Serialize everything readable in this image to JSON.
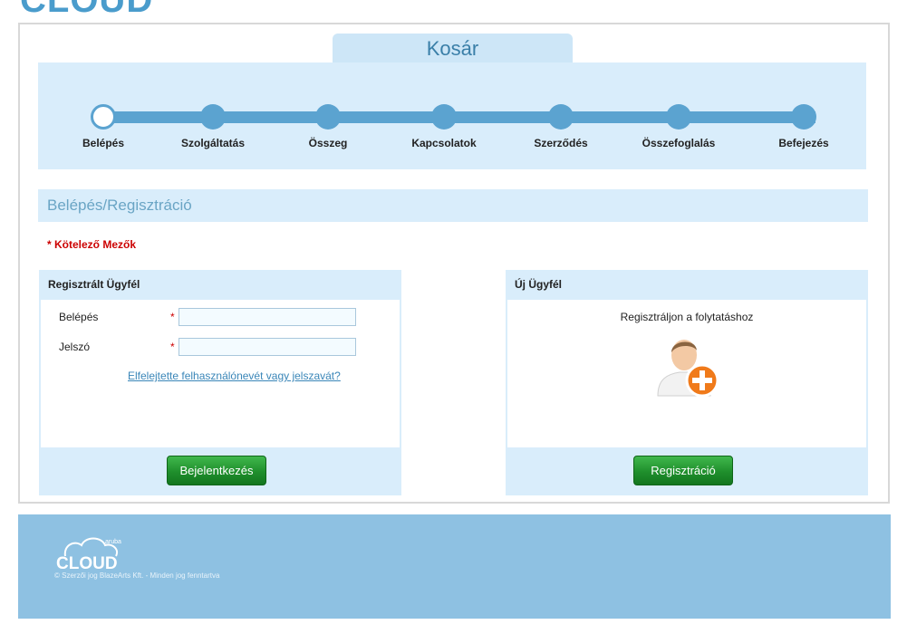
{
  "brand": {
    "logo_text": "CLOUD",
    "footer_logo_small": "aruba",
    "footer_logo_text": "CLOUD"
  },
  "cart": {
    "tab_title": "Kosár",
    "steps": [
      "Belépés",
      "Szolgáltatás",
      "Összeg",
      "Kapcsolatok",
      "Szerződés",
      "Összefoglalás",
      "Befejezés"
    ],
    "current_step_index": 0
  },
  "section": {
    "title": "Belépés/Regisztráció",
    "required_note": "* Kötelező Mezők"
  },
  "login_panel": {
    "header": "Regisztrált Ügyfél",
    "username_label": "Belépés",
    "username_value": "",
    "password_label": "Jelszó",
    "password_value": "",
    "required_mark": "*",
    "forgot_link": "Elfelejtette felhasználónevét vagy jelszavát?",
    "login_button": "Bejelentkezés"
  },
  "register_panel": {
    "header": "Új Ügyfél",
    "prompt": "Regisztráljon a folytatáshoz",
    "register_button": "Regisztráció"
  },
  "footer": {
    "copyright": "© Szerzői jog BlazeArts Kft. - Minden jog fenntartva"
  },
  "colors": {
    "accent": "#5ba3d0",
    "panel_bg": "#d9edfb",
    "button_green": "#1f8f2c",
    "required_red": "#cc0000",
    "footer_bg": "#8ec1e2"
  }
}
